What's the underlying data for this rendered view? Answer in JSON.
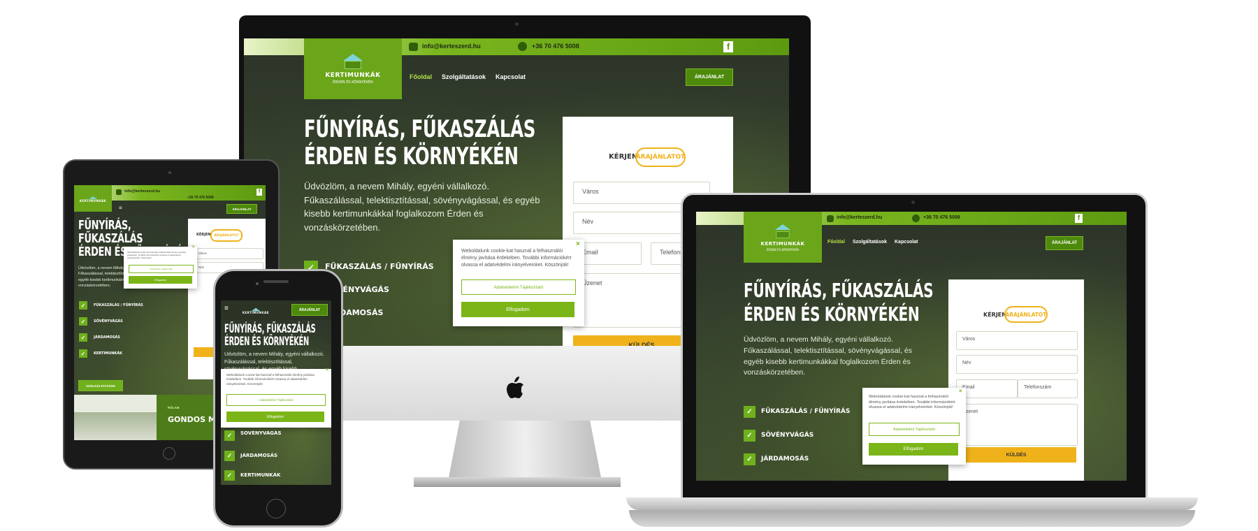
{
  "site": {
    "email": "info@kerteszerd.hu",
    "phone": "+36 70 476 5008",
    "social_icon": "facebook-icon",
    "logo_title": "KERTIMUNKÁK",
    "logo_sub": "ÉRDEN ÉS KÖRNYÉKÉN",
    "nav": [
      "Főoldal",
      "Szolgáltatások",
      "Kapcsolat"
    ],
    "cta": "ÁRAJÁNLAT",
    "hero_title_line1": "FŰNYÍRÁS, FŰKASZÁLÁS",
    "hero_title_line2": "ÉRDEN ÉS KÖRNYÉKÉN",
    "hero_text": "Üdvözlöm, a nevem Mihály, egyéni vállalkozó. Fűkaszálással, telektisztítással, sövényvágással, és egyéb kisebb kertimunkákkal foglalkozom Érden és vonzáskörzetében.",
    "quote_word": "KÉRJEN",
    "quote_highlight": "ÁRAJÁNLATOT",
    "form": {
      "city": "Város",
      "name": "Név",
      "email": "Email",
      "phone": "Telefonszám",
      "message": "Üzenet",
      "send": "KÜLDÉS"
    },
    "services": [
      "FŰKASZÁLÁS / FŰNYÍRÁS",
      "SÖVÉNYVÁGÁS",
      "JÁRDAMOSÁS",
      "KERTIMUNKÁK"
    ],
    "services_btn": "SZOLGÁLTATÁSOK",
    "rolam": "RÓLAM",
    "gondos": "GONDOS MUNKA",
    "cookie": {
      "text": "Weboldalunk cookie-kat használ a felhasználói élmény javítása érdekében. További információkért olvassa el adatvédelmi irányelveinket. Köszönjük!",
      "info": "Adatvédelmi Tájékoztató",
      "accept": "Elfogadom",
      "close": "×"
    }
  },
  "colors": {
    "brand_green": "#6aa51a",
    "accent_yellow": "#f0b21a"
  }
}
